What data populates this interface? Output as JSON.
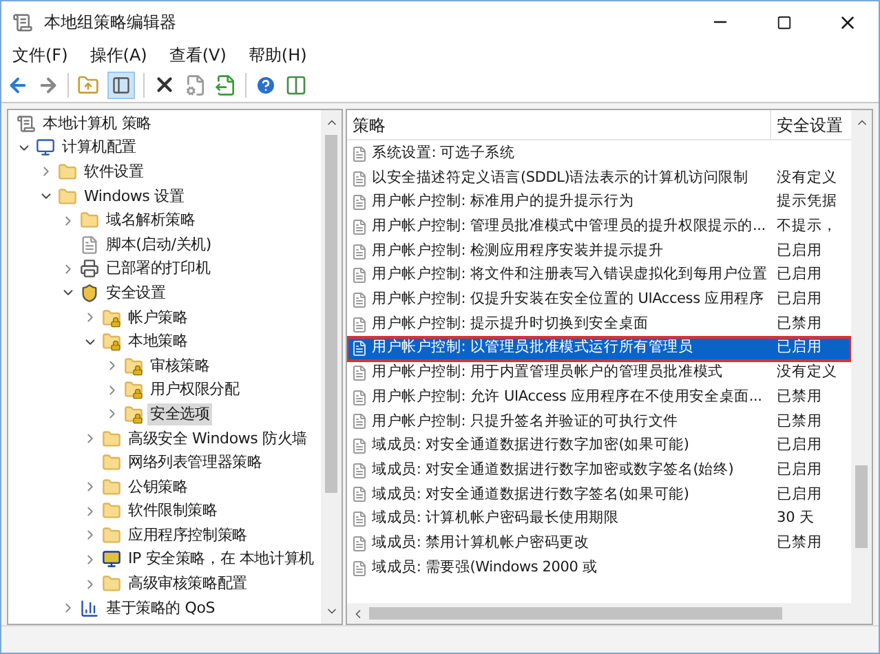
{
  "window": {
    "title": "本地组策略编辑器"
  },
  "menu": [
    "文件(F)",
    "操作(A)",
    "查看(V)",
    "帮助(H)"
  ],
  "tree": [
    {
      "label": "本地计算机 策略",
      "kind": "doc",
      "selected": false,
      "children": [
        {
          "label": "计算机配置",
          "kind": "computer",
          "expanded": true,
          "selected": false,
          "children": [
            {
              "label": "软件设置",
              "kind": "folder",
              "expanded": false,
              "selected": false
            },
            {
              "label": "Windows 设置",
              "kind": "folder",
              "expanded": true,
              "selected": false,
              "children": [
                {
                  "label": "域名解析策略",
                  "kind": "folder",
                  "expanded": false,
                  "selected": false
                },
                {
                  "label": "脚本(启动/关机)",
                  "kind": "script",
                  "selected": false
                },
                {
                  "label": "已部署的打印机",
                  "kind": "printer",
                  "expanded": false,
                  "selected": false
                },
                {
                  "label": "安全设置",
                  "kind": "security",
                  "expanded": true,
                  "selected": false,
                  "children": [
                    {
                      "label": "帐户策略",
                      "kind": "lockfolder",
                      "expanded": false,
                      "selected": false
                    },
                    {
                      "label": "本地策略",
                      "kind": "lockfolder",
                      "expanded": true,
                      "selected": false,
                      "children": [
                        {
                          "label": "审核策略",
                          "kind": "lockfolder",
                          "expanded": false,
                          "selected": false
                        },
                        {
                          "label": "用户权限分配",
                          "kind": "lockfolder",
                          "expanded": false,
                          "selected": false
                        },
                        {
                          "label": "安全选项",
                          "kind": "lockfolder",
                          "expanded": false,
                          "selected": true
                        }
                      ]
                    },
                    {
                      "label": "高级安全 Windows 防火墙",
                      "kind": "folder",
                      "expanded": false,
                      "selected": false
                    },
                    {
                      "label": "网络列表管理器策略",
                      "kind": "folder",
                      "selected": false
                    },
                    {
                      "label": "公钥策略",
                      "kind": "folder",
                      "expanded": false,
                      "selected": false
                    },
                    {
                      "label": "软件限制策略",
                      "kind": "folder",
                      "expanded": false,
                      "selected": false
                    },
                    {
                      "label": "应用程序控制策略",
                      "kind": "folder",
                      "expanded": false,
                      "selected": false
                    },
                    {
                      "label": "IP 安全策略，在 本地计算机",
                      "kind": "ip",
                      "expanded": false,
                      "selected": false
                    },
                    {
                      "label": "高级审核策略配置",
                      "kind": "folder",
                      "expanded": false,
                      "selected": false
                    }
                  ]
                },
                {
                  "label": "基于策略的 QoS",
                  "kind": "chart",
                  "expanded": false,
                  "selected": false
                }
              ]
            }
          ]
        }
      ]
    }
  ],
  "table": {
    "columns": [
      "策略",
      "安全设置"
    ],
    "rows": [
      {
        "policy": "系统设置: 可选子系统",
        "setting": "",
        "selected": false,
        "outlined": false
      },
      {
        "policy": "以安全描述符定义语言(SDDL)语法表示的计算机访问限制",
        "setting": "没有定义",
        "selected": false,
        "outlined": false
      },
      {
        "policy": "用户帐户控制: 标准用户的提升提示行为",
        "setting": "提示凭据",
        "selected": false,
        "outlined": false
      },
      {
        "policy": "用户帐户控制: 管理员批准模式中管理员的提升权限提示的...",
        "setting": "不提示，",
        "selected": false,
        "outlined": false
      },
      {
        "policy": "用户帐户控制: 检测应用程序安装并提示提升",
        "setting": "已启用",
        "selected": false,
        "outlined": false
      },
      {
        "policy": "用户帐户控制: 将文件和注册表写入错误虚拟化到每用户位置",
        "setting": "已启用",
        "selected": false,
        "outlined": false
      },
      {
        "policy": "用户帐户控制: 仅提升安装在安全位置的 UIAccess 应用程序",
        "setting": "已启用",
        "selected": false,
        "outlined": false
      },
      {
        "policy": "用户帐户控制: 提示提升时切换到安全桌面",
        "setting": "已禁用",
        "selected": false,
        "outlined": false
      },
      {
        "policy": "用户帐户控制: 以管理员批准模式运行所有管理员",
        "setting": "已启用",
        "selected": true,
        "outlined": true
      },
      {
        "policy": "用户帐户控制: 用于内置管理员帐户的管理员批准模式",
        "setting": "没有定义",
        "selected": false,
        "outlined": false
      },
      {
        "policy": "用户帐户控制: 允许 UIAccess 应用程序在不使用安全桌面...",
        "setting": "已禁用",
        "selected": false,
        "outlined": false
      },
      {
        "policy": "用户帐户控制: 只提升签名并验证的可执行文件",
        "setting": "已禁用",
        "selected": false,
        "outlined": false
      },
      {
        "policy": "域成员: 对安全通道数据进行数字加密(如果可能)",
        "setting": "已启用",
        "selected": false,
        "outlined": false
      },
      {
        "policy": "域成员: 对安全通道数据进行数字加密或数字签名(始终)",
        "setting": "已启用",
        "selected": false,
        "outlined": false
      },
      {
        "policy": "域成员: 对安全通道数据进行数字签名(如果可能)",
        "setting": "已启用",
        "selected": false,
        "outlined": false
      },
      {
        "policy": "域成员: 计算机帐户密码最长使用期限",
        "setting": "30 天",
        "selected": false,
        "outlined": false
      },
      {
        "policy": "域成员: 禁用计算机帐户密码更改",
        "setting": "已禁用",
        "selected": false,
        "outlined": false
      },
      {
        "policy": "域成员: 需要强(Windows 2000 或",
        "setting": "",
        "selected": false,
        "outlined": false
      }
    ]
  }
}
